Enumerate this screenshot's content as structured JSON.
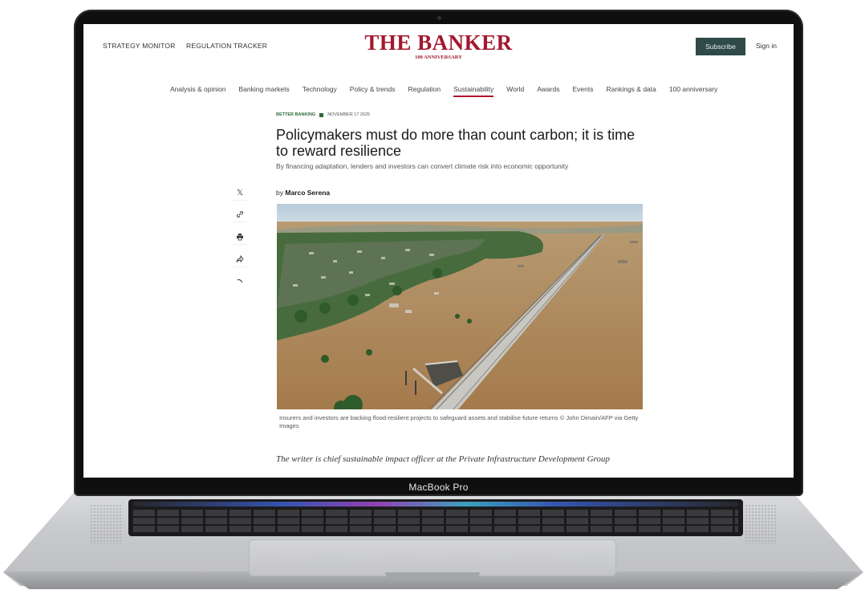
{
  "device": {
    "chin_label": "MacBook Pro"
  },
  "site": {
    "logo": "THE BANKER",
    "logo_sub": "100 ANNIVERSARY",
    "utility_links": [
      "STRATEGY MONITOR",
      "REGULATION TRACKER"
    ],
    "subscribe_label": "Subscribe",
    "signin_label": "Sign in",
    "nav": [
      "Analysis & opinion",
      "Banking markets",
      "Technology",
      "Policy & trends",
      "Regulation",
      "Sustainability",
      "World",
      "Awards",
      "Events",
      "Rankings & data",
      "100 anniversary"
    ],
    "active_nav": "Sustainability",
    "accent_color": "#a3182f",
    "button_color": "#2f4a48"
  },
  "article": {
    "section": "BETTER BANKING",
    "date": "NOVEMBER 17 2025",
    "headline": "Policymakers must do more than count carbon; it is time to reward resilience",
    "standfirst": "By financing adaptation, lenders and investors can convert climate risk into economic opportunity",
    "byline_prefix": "by",
    "author": "Marco Serena",
    "share_icons": [
      "x-icon",
      "link-icon",
      "print-icon",
      "share-icon"
    ],
    "image_caption": "Insurers and investors are backing flood-resilient projects to safeguard assets and stabilise future returns © John Dimain/AFP via Getty Images",
    "writer_note": "The writer is chief sustainable impact officer at the Private Infrastructure Development Group"
  }
}
